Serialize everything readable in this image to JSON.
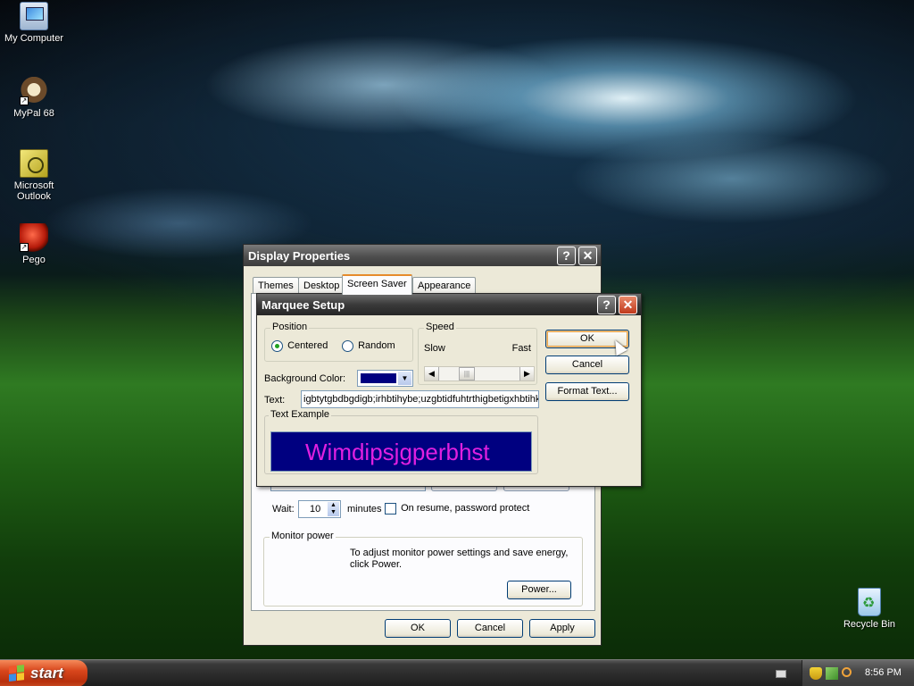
{
  "desktop": {
    "icons": [
      {
        "label": "My Computer"
      },
      {
        "label": "MyPal 68"
      },
      {
        "label": "Microsoft Outlook"
      },
      {
        "label": "Pego"
      },
      {
        "label": "Recycle Bin"
      }
    ]
  },
  "display_properties": {
    "title": "Display Properties",
    "tabs": [
      "Themes",
      "Desktop",
      "Screen Saver",
      "Appearance"
    ],
    "selected_tab": "Screen Saver",
    "wait_label": "Wait:",
    "wait_value": "10",
    "minutes_label": "minutes",
    "password_label": "On resume, password protect",
    "password_checked": false,
    "monitor_power": {
      "label": "Monitor power",
      "text": "To adjust monitor power settings and save energy, click Power.",
      "button": "Power..."
    },
    "ok": "OK",
    "cancel": "Cancel",
    "apply": "Apply"
  },
  "marquee_setup": {
    "title": "Marquee Setup",
    "position": {
      "label": "Position",
      "options": [
        "Centered",
        "Random"
      ],
      "selected": "Centered"
    },
    "speed": {
      "label": "Speed",
      "slow": "Slow",
      "fast": "Fast",
      "value": 0.3
    },
    "background_color_label": "Background Color:",
    "background_color": "#000080",
    "text_label": "Text:",
    "text_value": "igbtytgbdbgdigb;irhbtihybe;uzgbtidfuhtrthigbetigxhbtihkg",
    "example_label": "Text Example",
    "example_text": "Wimdipsjgperbhst",
    "example_text_color": "#e020e0",
    "ok": "OK",
    "cancel": "Cancel",
    "format_text": "Format Text..."
  },
  "taskbar": {
    "start_label": "start",
    "clock": "8:56 PM"
  },
  "colors": {
    "accent_orange": "#e68b2c",
    "start_button": "#d8461c",
    "example_bg": "#000080"
  }
}
